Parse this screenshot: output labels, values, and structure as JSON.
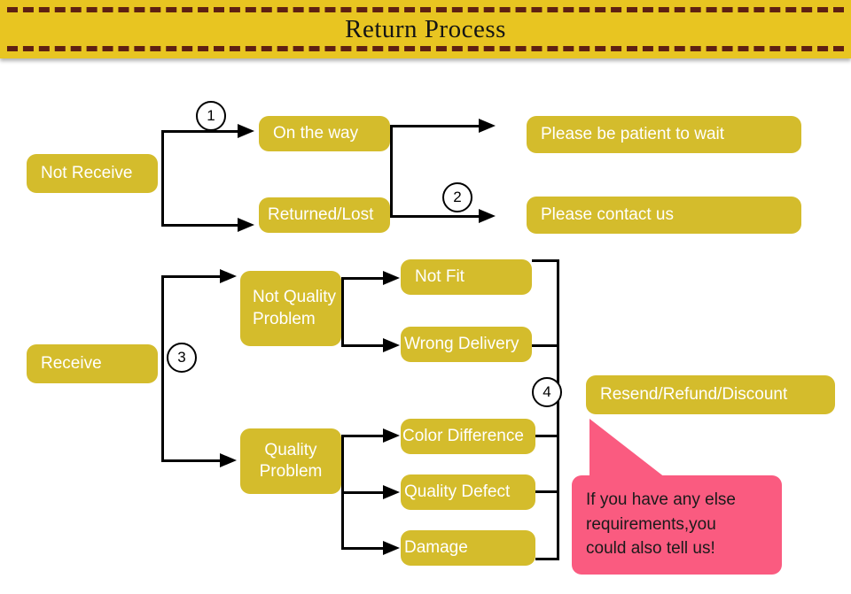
{
  "header": {
    "title": "Return Process",
    "background_color": "#E8C521",
    "dash_color": "#5E2012"
  },
  "theme": {
    "node_color": "#D4BC2C",
    "node_text_color": "#FFFFFF",
    "line_color": "#000000",
    "callout_color": "#FA5B80",
    "callout_text_color": "#1A1A1A",
    "page_background": "#FFFFFF"
  },
  "nodes": {
    "not_receive": "Not Receive",
    "on_the_way": "On the way",
    "returned_lost": "Returned/Lost",
    "please_wait": "Please be patient to wait",
    "please_contact": "Please contact us",
    "receive": "Receive",
    "not_quality_problem": "Not Quality Problem",
    "quality_problem": "Quality Problem",
    "not_fit": "Not Fit",
    "wrong_delivery": "Wrong Delivery",
    "color_difference": "Color Difference",
    "quality_defect": "Quality Defect",
    "damage": "Damage",
    "resend_refund_discount": "Resend/Refund/Discount"
  },
  "steps": {
    "one": "1",
    "two": "2",
    "three": "3",
    "four": "4"
  },
  "callout": {
    "line1": "If you have any else",
    "line2": "requirements,you",
    "line3": "could also tell us!"
  }
}
